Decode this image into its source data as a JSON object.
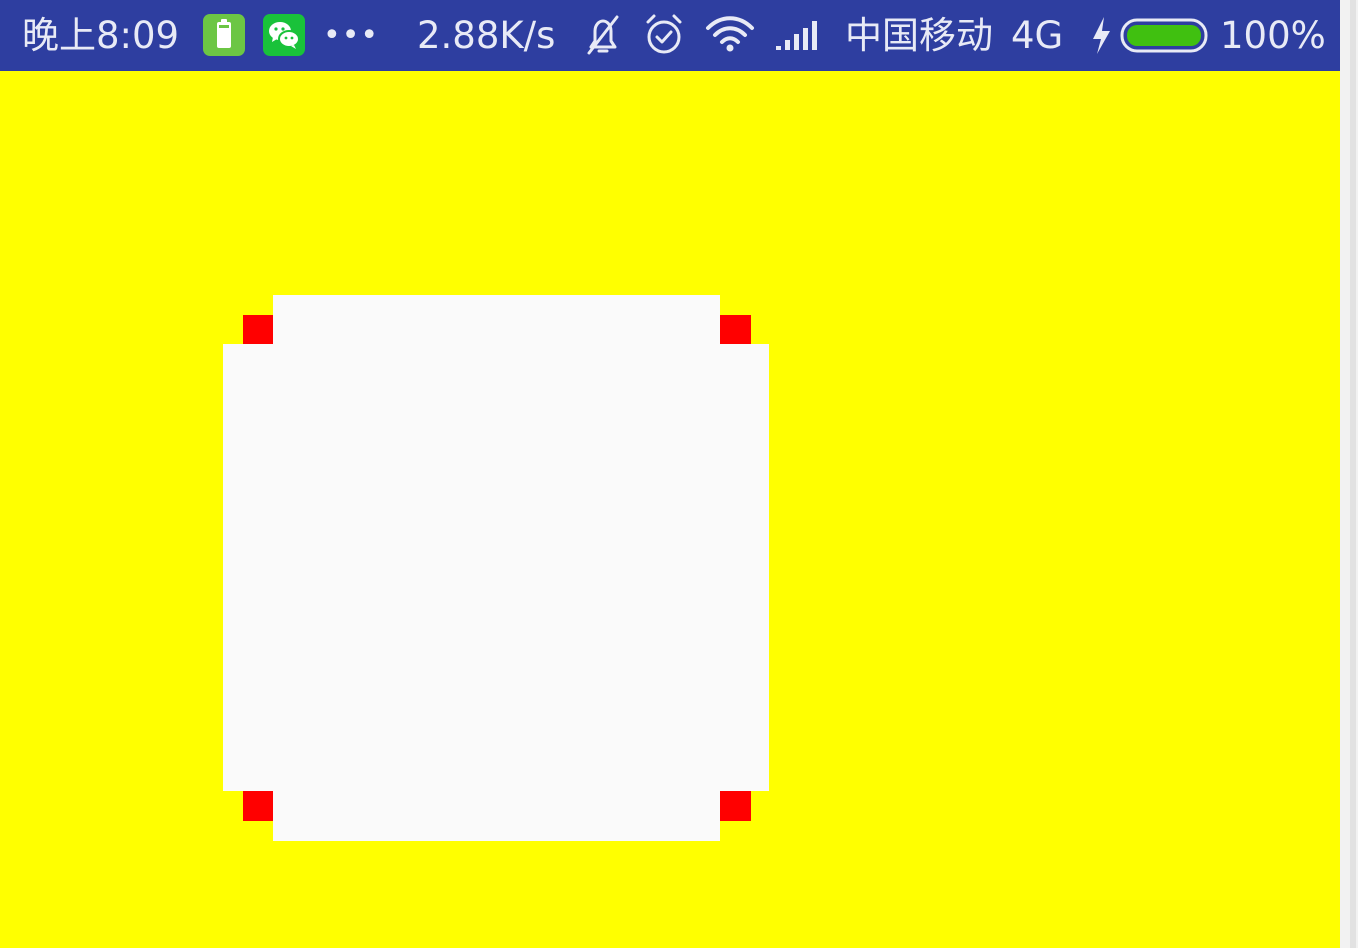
{
  "status_bar": {
    "time": "晚上8:09",
    "more": "•••",
    "network_speed": "2.88K/s",
    "carrier": "中国移动",
    "network_type": "4G",
    "battery_percent": "100%",
    "battery_level": 1.0,
    "background_color": "#2e3ea0",
    "text_color": "#e8eaf6",
    "icons": [
      "battery-app-icon",
      "wechat-icon",
      "bell-muted-icon",
      "alarm-icon",
      "wifi-icon",
      "signal-icon",
      "charging-icon",
      "battery-icon"
    ]
  },
  "canvas": {
    "background_color": "#ffff00",
    "frame_color": "#ff0000",
    "panel_color": "#fafafa"
  }
}
